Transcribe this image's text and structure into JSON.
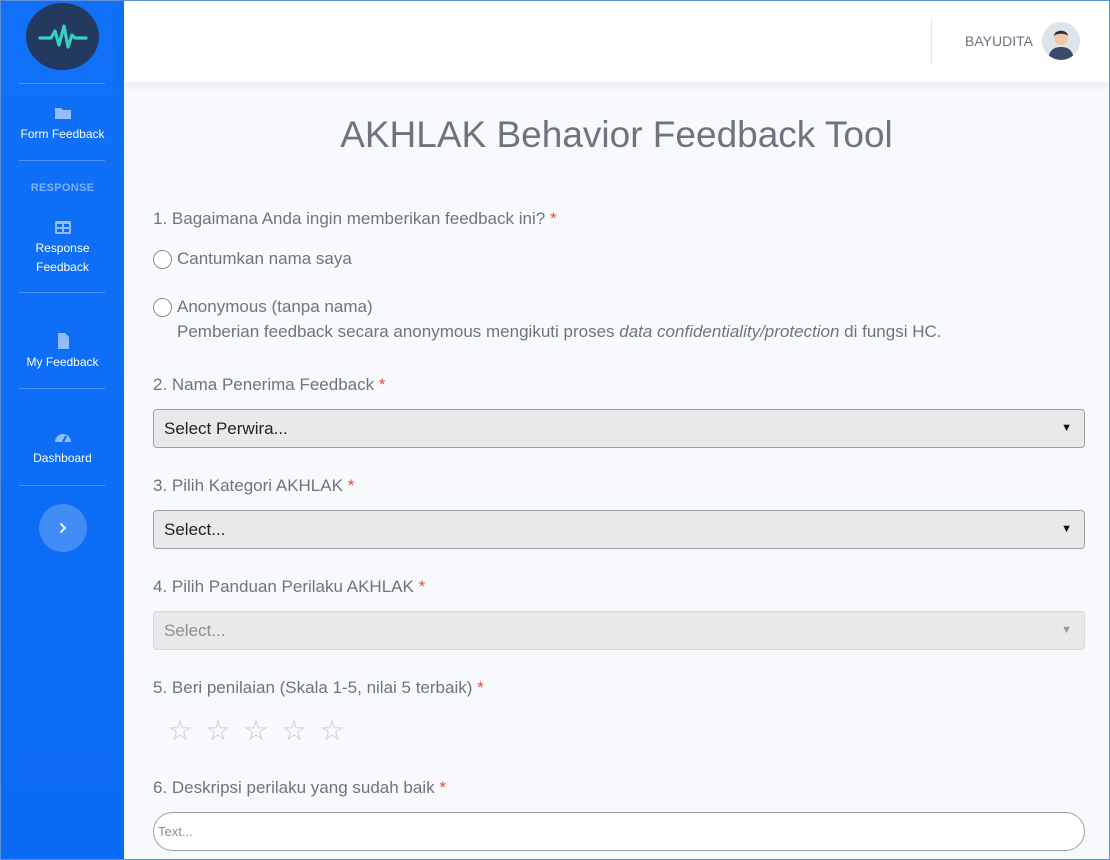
{
  "sidebar": {
    "items": [
      {
        "label": "Form Feedback",
        "icon": "folder-icon"
      },
      {
        "label": "Response Feedback",
        "icon": "table-icon"
      },
      {
        "label": "My Feedback",
        "icon": "file-icon"
      },
      {
        "label": "Dashboard",
        "icon": "gauge-icon"
      }
    ],
    "heading": "RESPONSE",
    "toggle_icon": "chevron-right-icon"
  },
  "topbar": {
    "username": "BAYUDITA"
  },
  "page": {
    "title": "AKHLAK Behavior Feedback Tool"
  },
  "form": {
    "q1": {
      "label": "1. Bagaimana Anda ingin memberikan feedback ini?",
      "required_mark": "*",
      "option1": "Cantumkan nama saya",
      "option2": "Anonymous (tanpa nama)",
      "note_before": "Pemberian feedback secara anonymous mengikuti proses ",
      "note_italic": "data confidentiality/protection",
      "note_after": " di fungsi HC."
    },
    "q2": {
      "label": "2. Nama Penerima Feedback",
      "required_mark": "*",
      "selected": "Select Perwira..."
    },
    "q3": {
      "label": "3. Pilih Kategori AKHLAK",
      "required_mark": "*",
      "selected": "Select..."
    },
    "q4": {
      "label": "4. Pilih Panduan Perilaku AKHLAK",
      "required_mark": "*",
      "selected": "Select..."
    },
    "q5": {
      "label": "5. Beri penilaian (Skala 1-5, nilai 5 terbaik)",
      "required_mark": "*",
      "rating": 0,
      "max_rating": 5
    },
    "q6": {
      "label": "6. Deskripsi perilaku yang sudah baik",
      "required_mark": "*",
      "placeholder": "Text..."
    }
  },
  "colors": {
    "sidebar": "#0b6af5",
    "logo_bg": "#23395d",
    "pulse": "#36d1c4",
    "required": "#e74a3b"
  }
}
